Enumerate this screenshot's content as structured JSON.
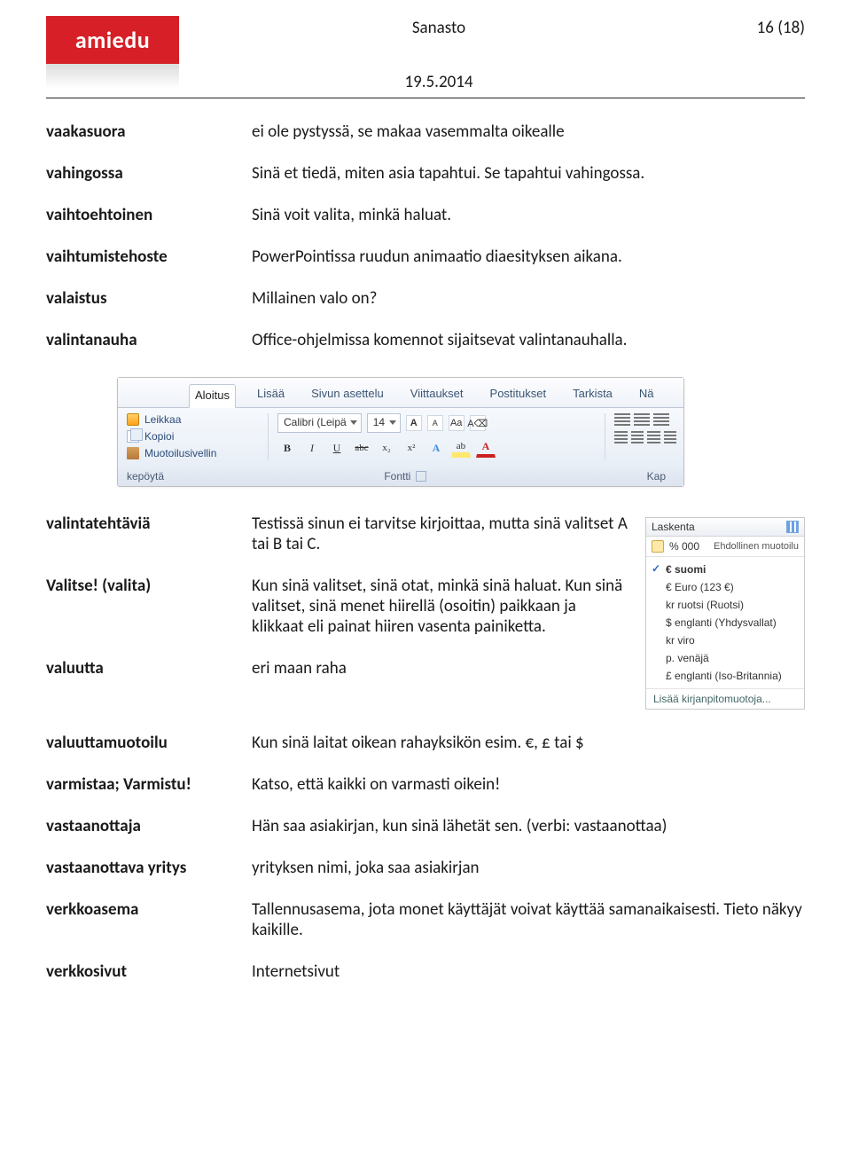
{
  "header": {
    "logo_text": "amiedu",
    "title": "Sanasto",
    "page_indicator": "16 (18)",
    "date": "19.5.2014"
  },
  "group1": [
    {
      "term": "vaakasuora",
      "def": "ei ole pystyssä, se makaa vasemmalta oikealle"
    },
    {
      "term": "vahingossa",
      "def": "Sinä et tiedä, miten asia tapahtui. Se tapahtui vahingossa."
    },
    {
      "term": "vaihtoehtoinen",
      "def": "Sinä voit valita, minkä haluat."
    },
    {
      "term": "vaihtumistehoste",
      "def": "PowerPointissa ruudun animaatio diaesityksen aikana."
    },
    {
      "term": "valaistus",
      "def": "Millainen valo on?"
    },
    {
      "term": "valintanauha",
      "def": "Office-ohjelmissa komennot sijaitsevat valintanauhalla."
    }
  ],
  "ribbon": {
    "tabs": [
      "Aloitus",
      "Lisää",
      "Sivun asettelu",
      "Viittaukset",
      "Postitukset",
      "Tarkista",
      "Nä"
    ],
    "clipboard": {
      "cut": "Leikkaa",
      "copy": "Kopioi",
      "painter": "Muotoilusivellin",
      "group_label": "kepöytä"
    },
    "font": {
      "name": "Calibri (Leipä",
      "size": "14",
      "grow": "A",
      "shrink": "A",
      "case": "Aa",
      "clear": "A⌫",
      "bold": "B",
      "italic": "I",
      "underline": "U",
      "strike": "abc",
      "sub": "x₂",
      "sup": "x²",
      "texteffects": "A",
      "highlight": "ab",
      "fontcolor": "A",
      "group_label": "Fontti"
    },
    "paragraph": {
      "group_label": "Kap"
    }
  },
  "group2": [
    {
      "term": "valintatehtäviä",
      "def": "Testissä sinun ei tarvitse kirjoittaa, mutta sinä valitset A tai B tai C."
    },
    {
      "term": "Valitse! (valita)",
      "def": "Kun sinä valitset, sinä otat, minkä sinä haluat. Kun sinä valitset, sinä menet hiirellä (osoitin) paikkaan ja klikkaat eli painat hiiren vasenta painiketta."
    },
    {
      "term": "valuutta",
      "def": "eri maan raha"
    }
  ],
  "dropdown": {
    "head_left": "Laskenta",
    "sub_text": "% 000",
    "sub_right": "Ehdollinen muotoilu",
    "items": [
      {
        "label": "€ suomi",
        "checked": true
      },
      {
        "label": "€ Euro (123 €)"
      },
      {
        "label": "kr ruotsi (Ruotsi)"
      },
      {
        "label": "$ englanti (Yhdysvallat)"
      },
      {
        "label": "kr viro"
      },
      {
        "label": "p. venäjä"
      },
      {
        "label": "£ englanti (Iso-Britannia)"
      }
    ],
    "footer": "Lisää kirjanpitomuotoja..."
  },
  "group3": [
    {
      "term": "valuuttamuotoilu",
      "def": "Kun sinä laitat oikean rahayksikön esim. €, £ tai $"
    },
    {
      "term": "varmistaa; Varmistu!",
      "def": "Katso, että kaikki on varmasti oikein!"
    },
    {
      "term": "vastaanottaja",
      "def": "Hän saa asiakirjan, kun sinä lähetät sen. (verbi: vastaanottaa)"
    },
    {
      "term": "vastaanottava yritys",
      "def": "yrityksen nimi, joka saa asiakirjan"
    },
    {
      "term": "verkkoasema",
      "def": "Tallennusasema, jota monet käyttäjät voivat käyttää samanaikaisesti. Tieto näkyy kaikille."
    },
    {
      "term": "verkkosivut",
      "def": "Internetsivut"
    }
  ]
}
